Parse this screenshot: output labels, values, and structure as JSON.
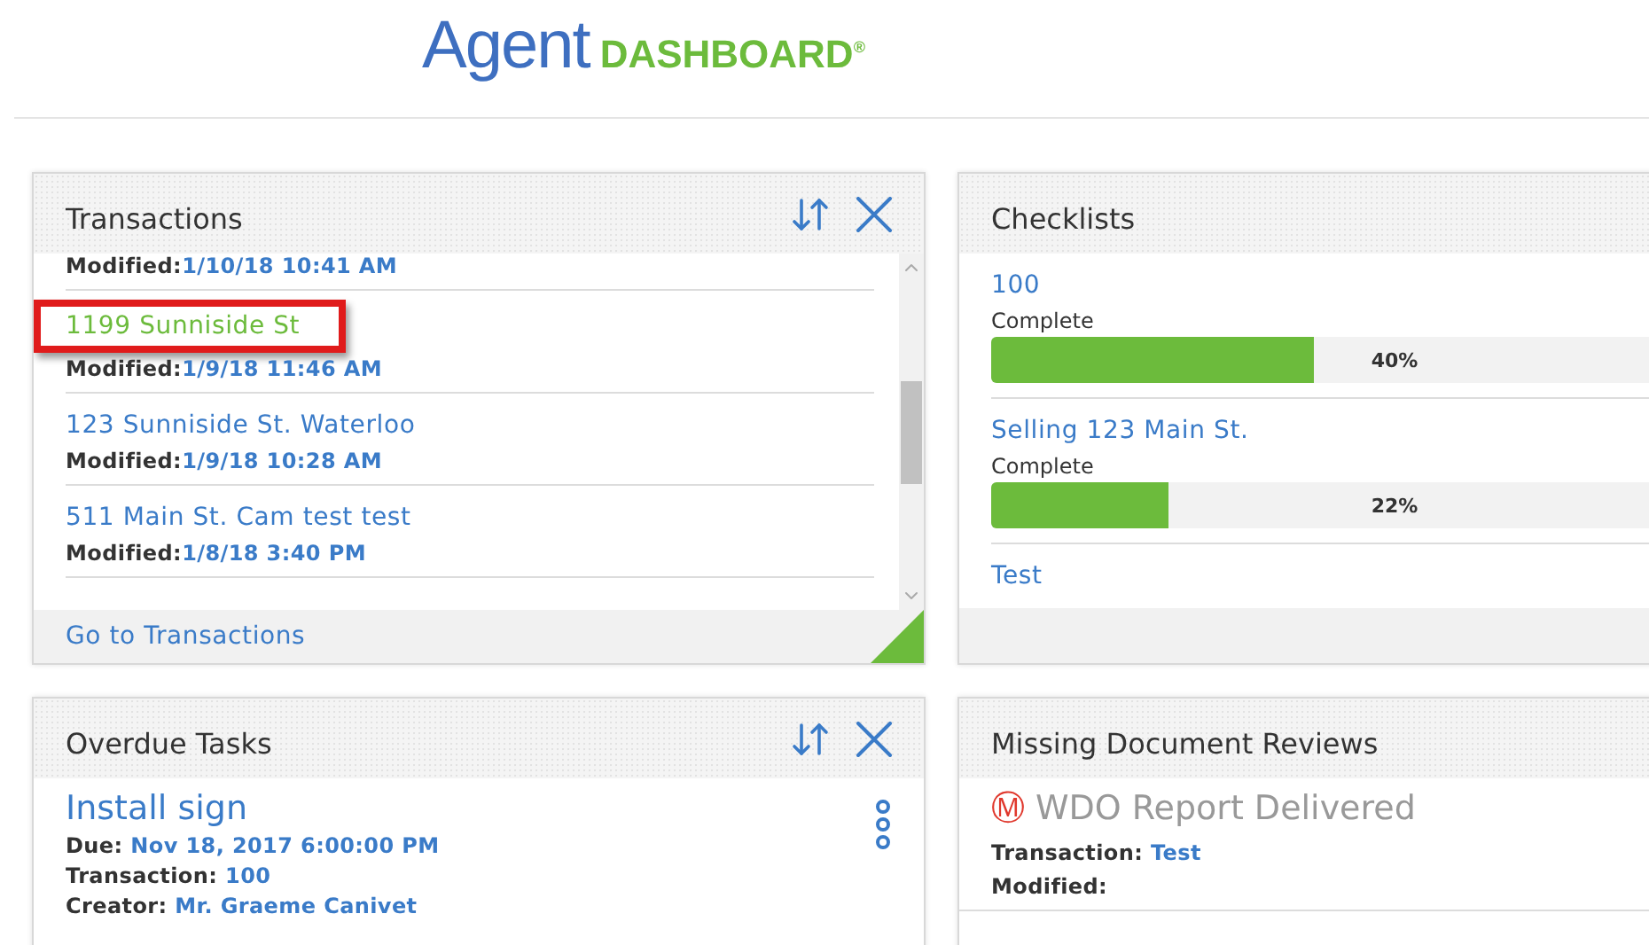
{
  "logo": {
    "word": "Agent",
    "accent": "DASHBOARD",
    "mark": "®"
  },
  "transactions": {
    "title": "Transactions",
    "items": [
      {
        "modified_label": "Modified:",
        "modified": "1/10/18 10:41 AM",
        "highlighted": false
      },
      {
        "name": "1199 Sunniside St",
        "modified_label": "Modified:",
        "modified": "1/9/18 11:46 AM",
        "highlighted": true
      },
      {
        "name": "123 Sunniside St. Waterloo",
        "modified_label": "Modified:",
        "modified": "1/9/18 10:28 AM",
        "highlighted": false
      },
      {
        "name": "511 Main St. Cam test test",
        "modified_label": "Modified:",
        "modified": "1/8/18 3:40 PM",
        "highlighted": false
      }
    ],
    "footer_link": "Go to Transactions"
  },
  "checklists": {
    "title": "Checklists",
    "items": [
      {
        "name": "100",
        "status": "Complete",
        "level": 0.4,
        "reading": "40%"
      },
      {
        "name": "Selling 123 Main St.",
        "status": "Complete",
        "level": 0.22,
        "reading": "22%"
      },
      {
        "name": "Test"
      }
    ]
  },
  "overdue_tasks": {
    "title": "Overdue Tasks",
    "tasks": [
      {
        "name": "Install sign",
        "fields": [
          {
            "label": "Due:",
            "value": "Nov 18, 2017 6:00:00 PM"
          },
          {
            "label": "Transaction:",
            "value": "100"
          },
          {
            "label": "Creator:",
            "value": "Mr. Graeme Canivet"
          }
        ]
      }
    ]
  },
  "missing_reviews": {
    "title": "Missing Document Reviews",
    "items": [
      {
        "badge": "Ⓜ",
        "name": "WDO Report Delivered",
        "fields": [
          {
            "label": "Transaction:",
            "value": "Test"
          },
          {
            "label": "Modified:"
          }
        ]
      }
    ]
  }
}
